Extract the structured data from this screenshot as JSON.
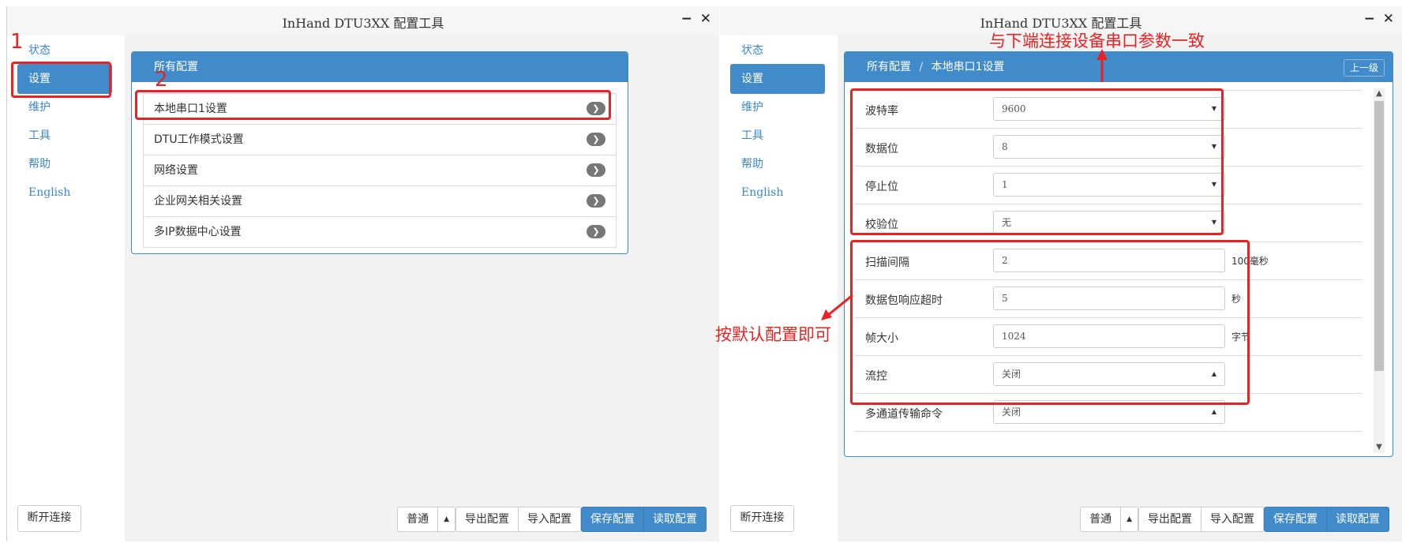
{
  "window_left": {
    "title": "InHand DTU3XX 配置工具",
    "controls": {
      "minimize": "−",
      "close": "✕"
    },
    "sidebar": {
      "items": [
        {
          "label": "状态",
          "active": false
        },
        {
          "label": "设置",
          "active": true
        },
        {
          "label": "维护",
          "active": false
        },
        {
          "label": "工具",
          "active": false
        },
        {
          "label": "帮助",
          "active": false
        },
        {
          "label": "English",
          "active": false
        }
      ],
      "disconnect_label": "断开连接"
    },
    "panel": {
      "title": "所有配置",
      "items": [
        {
          "label": "本地串口1设置"
        },
        {
          "label": "DTU工作模式设置"
        },
        {
          "label": "网络设置"
        },
        {
          "label": "企业网关相关设置"
        },
        {
          "label": "多IP数据中心设置"
        }
      ],
      "chevron": "❯"
    },
    "toolbar": {
      "mode_label": "普通",
      "mode_caret": "▲",
      "export_label": "导出配置",
      "import_label": "导入配置",
      "save_label": "保存配置",
      "read_label": "读取配置"
    },
    "annotations": {
      "step1": "1",
      "step2": "2"
    }
  },
  "window_right": {
    "title": "InHand DTU3XX 配置工具",
    "controls": {
      "minimize": "−",
      "close": "✕"
    },
    "sidebar": {
      "items": [
        {
          "label": "状态",
          "active": false
        },
        {
          "label": "设置",
          "active": true
        },
        {
          "label": "维护",
          "active": false
        },
        {
          "label": "工具",
          "active": false
        },
        {
          "label": "帮助",
          "active": false
        },
        {
          "label": "English",
          "active": false
        }
      ],
      "disconnect_label": "断开连接"
    },
    "breadcrumb": {
      "root": "所有配置",
      "separator": "/",
      "current": "本地串口1设置"
    },
    "up_button_label": "上一级",
    "form": [
      {
        "label": "波特率",
        "type": "select",
        "value": "9600",
        "caret": "▼"
      },
      {
        "label": "数据位",
        "type": "select",
        "value": "8",
        "caret": "▼"
      },
      {
        "label": "停止位",
        "type": "select",
        "value": "1",
        "caret": "▼"
      },
      {
        "label": "校验位",
        "type": "select",
        "value": "无",
        "caret": "▼"
      },
      {
        "label": "扫描间隔",
        "type": "input",
        "value": "2",
        "unit": "100毫秒"
      },
      {
        "label": "数据包响应超时",
        "type": "input",
        "value": "5",
        "unit": "秒"
      },
      {
        "label": "帧大小",
        "type": "input",
        "value": "1024",
        "unit": "字节"
      },
      {
        "label": "流控",
        "type": "select",
        "value": "关闭",
        "caret": "▲"
      },
      {
        "label": "多通道传输命令",
        "type": "select",
        "value": "关闭",
        "caret": "▲"
      }
    ],
    "scroll_up": "▲",
    "scroll_down": "▼",
    "toolbar": {
      "mode_label": "普通",
      "mode_caret": "▲",
      "export_label": "导出配置",
      "import_label": "导入配置",
      "save_label": "保存配置",
      "read_label": "读取配置"
    },
    "annotations": {
      "top_note": "与下端连接设备串口参数一致",
      "left_note": "按默认配置即可"
    }
  },
  "colors": {
    "accent": "#428bca",
    "annotation": "#e82323"
  }
}
